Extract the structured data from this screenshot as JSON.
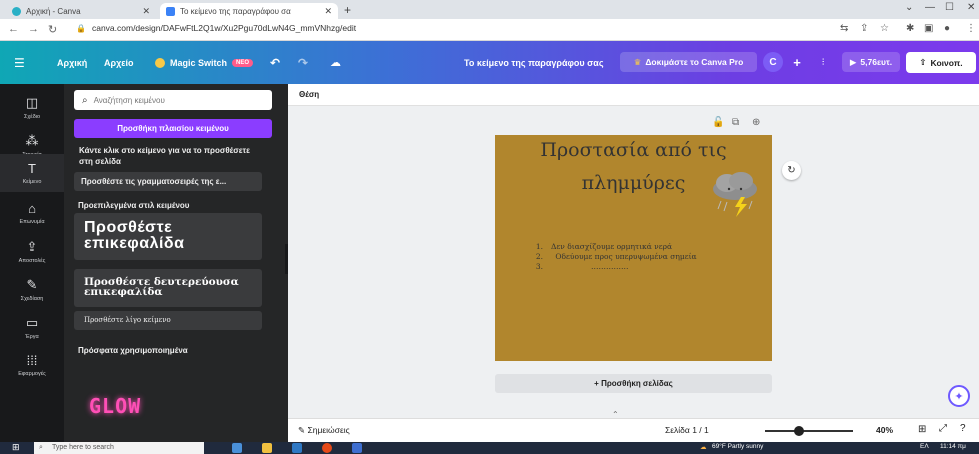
{
  "browser": {
    "tabs": [
      {
        "title": "Αρχική - Canva",
        "active": false
      },
      {
        "title": "Το κείμενο της παραγράφου σα",
        "active": true
      }
    ],
    "new_tab_symbol": "+",
    "url": "canva.com/design/DAFwFtL2Q1w/Xu2Pgu70dLwN4G_mmVNhzg/edit"
  },
  "header": {
    "nav": [
      "Αρχική",
      "Αρχείο"
    ],
    "magic_switch": "Magic Switch",
    "neo_badge": "NEO",
    "doc_title": "Το κείμενο της παραγράφου σας",
    "try_pro": "Δοκιμάστε το Canva Pro",
    "price": "5,76ευτ.",
    "share": "Κοινοπ."
  },
  "rail": {
    "items": [
      {
        "label": "Σχέδιο",
        "icon": "layout-icon"
      },
      {
        "label": "Στοιχεία",
        "icon": "elements-icon"
      },
      {
        "label": "Κείμενο",
        "icon": "text-icon",
        "active": true
      },
      {
        "label": "Επωνυμία",
        "icon": "brand-icon"
      },
      {
        "label": "Αποστολές",
        "icon": "upload-icon"
      },
      {
        "label": "Σχεδίαση",
        "icon": "draw-icon"
      },
      {
        "label": "Έργα",
        "icon": "folder-icon"
      },
      {
        "label": "Εφαρμογές",
        "icon": "apps-icon"
      }
    ]
  },
  "panel": {
    "search_placeholder": "Αναζήτηση κειμένου",
    "add_textbox": "Προσθήκη πλαισίου κειμένου",
    "hint": "Κάντε κλικ στο κείμενο για να το προσθέσετε στη σελίδα",
    "fonts_button": "Προσθέστε τις γραμματοσειρές της ε...",
    "default_styles_title": "Προεπιλεγμένα στιλ κειμένου",
    "heading": "Προσθέστε επικεφαλίδα",
    "subheading": "Προσθέστε δευτερεύουσα επικεφαλίδα",
    "body_text": "Προσθέστε λίγο κείμενο",
    "recent_title": "Πρόσφατα χρησιμοποιημένα",
    "glow_sample": "GLOW"
  },
  "workspace": {
    "position_label": "Θέση",
    "canvas_title_line1": "Προστασία από τις",
    "canvas_title_line2": "πλημμύρες",
    "canvas_list": [
      {
        "n": "1.",
        "text": "Δεν διασχίζουμε ορμητικά νερά"
      },
      {
        "n": "2.",
        "text": "Οδεύουμε προς υπερυψωμένα σημεία"
      },
      {
        "n": "3.",
        "text": "……………"
      }
    ],
    "canvas_bg": "#b1862d",
    "add_page": "+ Προσθήκη σελίδας"
  },
  "footer": {
    "notes": "Σημειώσεις",
    "page_indicator": "Σελίδα 1 / 1",
    "zoom": "40%",
    "zoom_fraction": 0.4
  },
  "taskbar": {
    "search_placeholder": "Type here to search",
    "weather": "69°F  Partly sunny",
    "time": "11:14 πμ",
    "lang": "ΕΛ"
  }
}
